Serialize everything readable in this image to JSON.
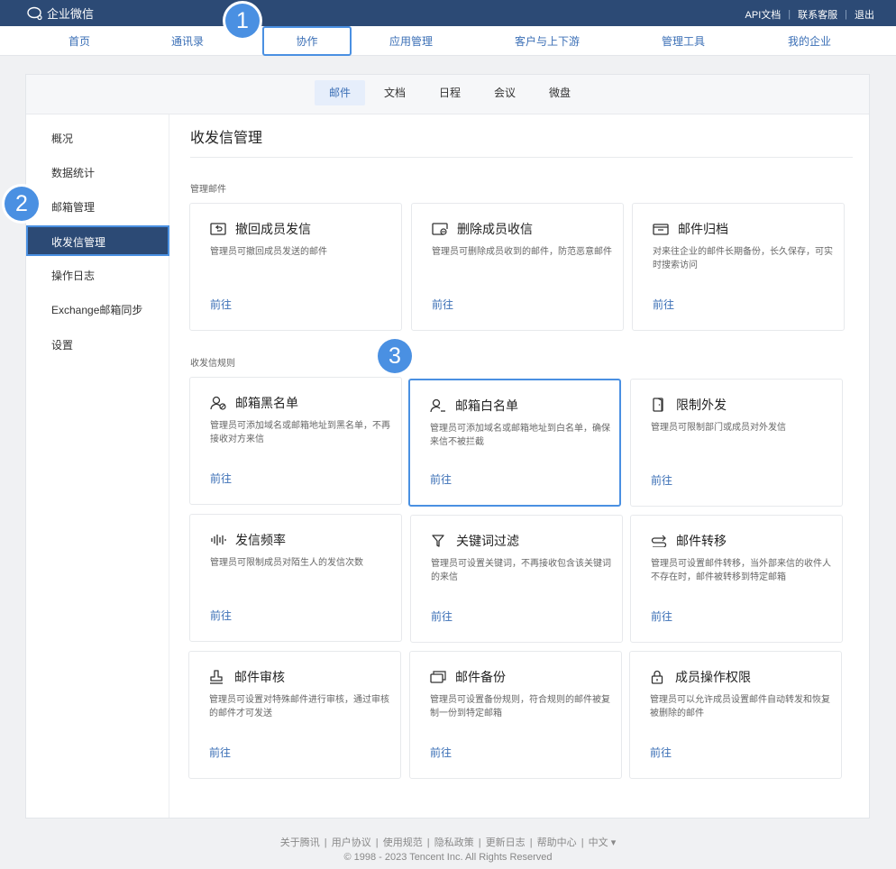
{
  "app": {
    "logo_text": "企业微信"
  },
  "top_links": [
    "API文档",
    "联系客服",
    "退出"
  ],
  "nav": [
    "首页",
    "通讯录",
    "协作",
    "应用管理",
    "客户与上下游",
    "管理工具",
    "我的企业"
  ],
  "badges": [
    "1",
    "2",
    "3"
  ],
  "subtabs": [
    "邮件",
    "文档",
    "日程",
    "会议",
    "微盘"
  ],
  "sidebar": [
    "概况",
    "数据统计",
    "邮箱管理",
    "收发信管理",
    "操作日志",
    "Exchange邮箱同步",
    "设置"
  ],
  "main": {
    "title": "收发信管理",
    "section1": "管理邮件",
    "section2": "收发信规则"
  },
  "cards": [
    {
      "icon": "recall-icon",
      "title": "撤回成员发信",
      "desc": "管理员可撤回成员发送的邮件",
      "link": "前往"
    },
    {
      "icon": "delete-mail-icon",
      "title": "删除成员收信",
      "desc": "管理员可删除成员收到的邮件，防范恶意邮件",
      "link": "前往"
    },
    {
      "icon": "archive-icon",
      "title": "邮件归档",
      "desc": "对来往企业的邮件长期备份，长久保存，可实时搜索访问",
      "link": "前往"
    },
    {
      "icon": "blacklist-icon",
      "title": "邮箱黑名单",
      "desc": "管理员可添加域名或邮箱地址到黑名单，不再接收对方来信",
      "link": "前往"
    },
    {
      "icon": "whitelist-icon",
      "title": "邮箱白名单",
      "desc": "管理员可添加域名或邮箱地址到白名单，确保来信不被拦截",
      "link": "前往"
    },
    {
      "icon": "door-icon",
      "title": "限制外发",
      "desc": "管理员可限制部门或成员对外发信",
      "link": "前往"
    },
    {
      "icon": "frequency-icon",
      "title": "发信频率",
      "desc": "管理员可限制成员对陌生人的发信次数",
      "link": "前往"
    },
    {
      "icon": "filter-icon",
      "title": "关键词过滤",
      "desc": "管理员可设置关键词，不再接收包含该关键词的来信",
      "link": "前往"
    },
    {
      "icon": "transfer-icon",
      "title": "邮件转移",
      "desc": "管理员可设置邮件转移，当外部来信的收件人不存在时，邮件被转移到特定邮箱",
      "link": "前往"
    },
    {
      "icon": "audit-stamp-icon",
      "title": "邮件审核",
      "desc": "管理员可设置对特殊邮件进行审核，通过审核的邮件才可发送",
      "link": "前往"
    },
    {
      "icon": "backup-icon",
      "title": "邮件备份",
      "desc": "管理员可设置备份规则，符合规则的邮件被复制一份到特定邮箱",
      "link": "前往"
    },
    {
      "icon": "lock-icon",
      "title": "成员操作权限",
      "desc": "管理员可以允许成员设置邮件自动转发和恢复被删除的邮件",
      "link": "前往"
    }
  ],
  "footer": {
    "links": [
      "关于腾讯",
      "用户协议",
      "使用规范",
      "隐私政策",
      "更新日志",
      "帮助中心",
      "中文 ▾"
    ],
    "copyright": "© 1998 - 2023 Tencent Inc. All Rights Reserved"
  },
  "colors": {
    "topbar": "#2c4a75",
    "accent": "#3b6fb6",
    "highlight": "#4a90e2"
  }
}
